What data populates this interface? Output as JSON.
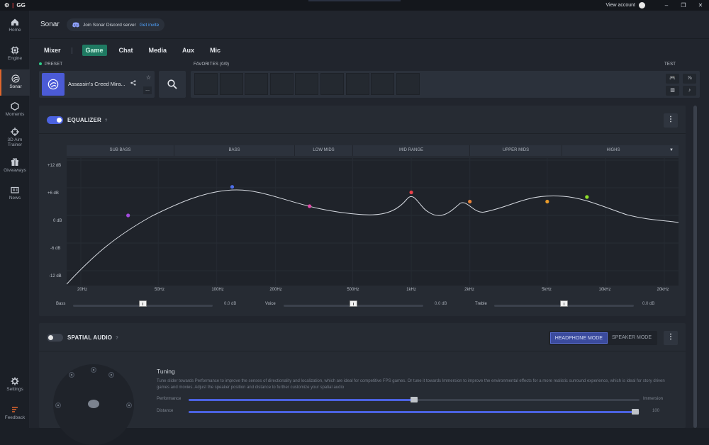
{
  "titlebar": {
    "logo": "GG",
    "account_label": "View account",
    "minimize": "–",
    "maximize": "❐",
    "close": "✕"
  },
  "sidebar": {
    "items": [
      {
        "label": "Home",
        "icon": "home-icon"
      },
      {
        "label": "Engine",
        "icon": "engine-icon"
      },
      {
        "label": "Sonar",
        "icon": "sonar-icon"
      },
      {
        "label": "Moments",
        "icon": "moments-icon"
      },
      {
        "label": "3D Aim Trainer",
        "icon": "crosshair-icon"
      },
      {
        "label": "Giveaways",
        "icon": "gift-icon"
      },
      {
        "label": "News",
        "icon": "news-icon"
      }
    ],
    "settings": "Settings",
    "feedback": "Feedback"
  },
  "header": {
    "title": "Sonar",
    "discord_text": "Join Sonar Discord server",
    "discord_link": "Get invite"
  },
  "tabs": {
    "mixer": "Mixer",
    "items": [
      "Game",
      "Chat",
      "Media",
      "Aux",
      "Mic"
    ],
    "active": "Game"
  },
  "preset": {
    "label": "PRESET",
    "name": "Assassin's Creed Mira...",
    "more": "..."
  },
  "favorites": {
    "label": "FAVORITES (0/9)",
    "slots": 9
  },
  "test": {
    "label": "TEST",
    "buttons": [
      "🎮",
      "⅞",
      "▥",
      "♪"
    ]
  },
  "equalizer": {
    "title": "EQUALIZER",
    "help": "?",
    "enabled": true,
    "bands": [
      "SUB BASS",
      "BASS",
      "LOW MIDS",
      "MID RANGE",
      "UPPER MIDS",
      "HIGHS"
    ],
    "y_labels": [
      "+12 dB",
      "+6 dB",
      "0 dB",
      "-6 dB",
      "-12 dB"
    ],
    "x_labels": [
      "20Hz",
      "50Hz",
      "100Hz",
      "200Hz",
      "500Hz",
      "1kHz",
      "2kHz",
      "5kHz",
      "10kHz",
      "20kHz"
    ],
    "points": [
      {
        "freq": "35Hz",
        "gain_db": 0,
        "color": "#a24bdc"
      },
      {
        "freq": "120Hz",
        "gain_db": 6.2,
        "color": "#4d6ee8"
      },
      {
        "freq": "300Hz",
        "gain_db": 2,
        "color": "#e24aa8"
      },
      {
        "freq": "1kHz",
        "gain_db": 5,
        "color": "#e8404a"
      },
      {
        "freq": "2kHz",
        "gain_db": 3,
        "color": "#e8823a"
      },
      {
        "freq": "5kHz",
        "gain_db": 3,
        "color": "#e89a2a"
      },
      {
        "freq": "8kHz",
        "gain_db": 4,
        "color": "#8fe02a"
      }
    ],
    "sliders": [
      {
        "label": "Bass",
        "value": "0.0 dB"
      },
      {
        "label": "Voice",
        "value": "0.0 dB"
      },
      {
        "label": "Treble",
        "value": "0.0 dB"
      }
    ]
  },
  "spatial": {
    "title": "SPATIAL AUDIO",
    "help": "?",
    "enabled": false,
    "modes": [
      "HEADPHONE MODE",
      "SPEAKER MODE"
    ],
    "active_mode": "HEADPHONE MODE",
    "tuning_title": "Tuning",
    "tuning_desc": "Tune slider towards Performance to improve the senses of directionality and localization, which are ideal for competitive FPS games. Or tune it towards Immersion to improve the environmental effects for a more realistic surround experience, which is ideal for story driven games and movies. Adjust the speaker position and distance to further customize your spatial audio",
    "performance_label": "Performance",
    "immersion_label": "Immersion",
    "distance_label": "Distance",
    "distance_value": "100",
    "performance_level": 0.5,
    "distance_level": 0.99
  }
}
